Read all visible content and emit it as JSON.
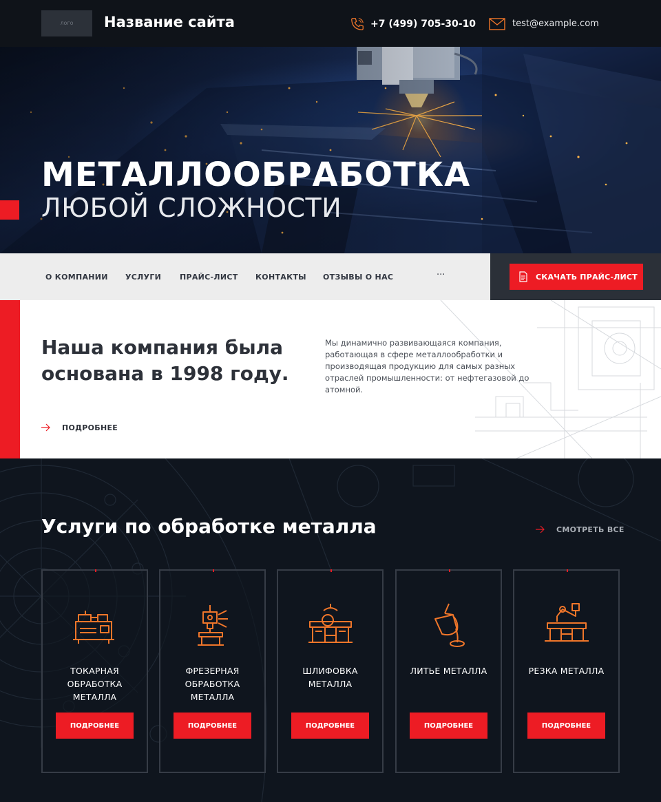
{
  "header": {
    "logo_text": "лого",
    "site_name": "Название сайта",
    "phone": "+7 (499) 705-30-10",
    "email": "test@example.com"
  },
  "hero": {
    "title": "МЕТАЛЛООБРАБОТКА",
    "subtitle": "ЛЮБОЙ СЛОЖНОСТИ"
  },
  "nav": {
    "items": [
      {
        "label": "О КОМПАНИИ"
      },
      {
        "label": "УСЛУГИ"
      },
      {
        "label": "ПРАЙС-ЛИСТ"
      },
      {
        "label": "КОНТАКТЫ"
      },
      {
        "label": "ОТЗЫВЫ О НАС"
      }
    ],
    "more": "···",
    "download_label": "СКАЧАТЬ ПРАЙС-ЛИСТ"
  },
  "about": {
    "title": "Наша компания была основана в 1998 году.",
    "text": "Мы динамично развивающаяся компания, работающая в сфере металлообработки и производящая продукцию для самых разных отраслей промышленности: от нефтегазовой до атомной.",
    "more_label": "ПОДРОБНЕЕ"
  },
  "services": {
    "title": "Услуги по обработке металла",
    "see_all_label": "СМОТРЕТЬ ВСЕ",
    "cards": [
      {
        "name": "ТОКАРНАЯ ОБРАБОТКА МЕТАЛЛА",
        "icon": "lathe-icon",
        "button": "ПОДРОБНЕЕ"
      },
      {
        "name": "ФРЕЗЕРНАЯ ОБРАБОТКА МЕТАЛЛА",
        "icon": "milling-machine-icon",
        "button": "ПОДРОБНЕЕ"
      },
      {
        "name": "ШЛИФОВКА МЕТАЛЛА",
        "icon": "grinding-machine-icon",
        "button": "ПОДРОБНЕЕ"
      },
      {
        "name": "ЛИТЬЕ МЕТАЛЛА",
        "icon": "casting-ladle-icon",
        "button": "ПОДРОБНЕЕ"
      },
      {
        "name": "РЕЗКА МЕТАЛЛА",
        "icon": "robotic-cutter-icon",
        "button": "ПОДРОБНЕЕ"
      }
    ]
  },
  "colors": {
    "accent": "#ed1c24",
    "icon_orange": "#f0762a",
    "dark_bg": "#0f151e",
    "header_bg": "#0f1319",
    "nav_bg": "#ededed"
  }
}
